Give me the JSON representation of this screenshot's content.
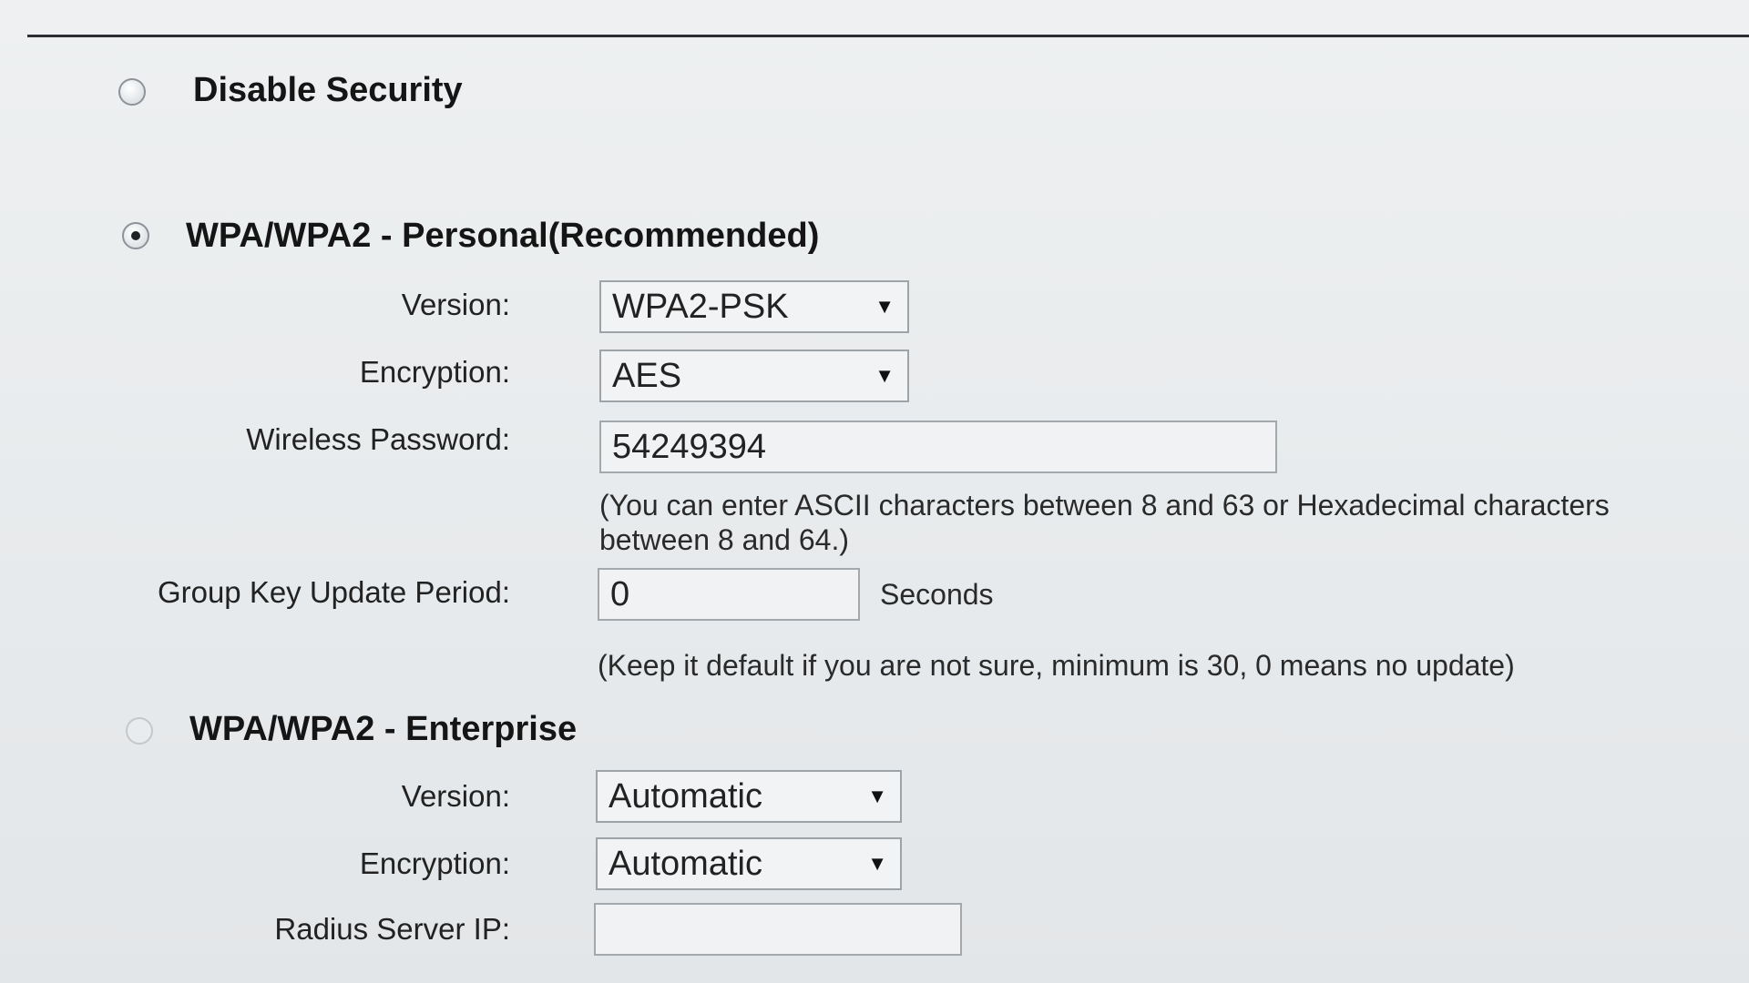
{
  "security": {
    "disable": {
      "label": "Disable Security",
      "selected": false
    },
    "personal": {
      "label": "WPA/WPA2 - Personal(Recommended)",
      "selected": true,
      "version_label": "Version:",
      "version_value": "WPA2-PSK",
      "encryption_label": "Encryption:",
      "encryption_value": "AES",
      "password_label": "Wireless Password:",
      "password_value": "54249394",
      "password_hint_line1": "(You can enter ASCII characters between 8 and 63 or Hexadecimal characters",
      "password_hint_line2": "between 8 and 64.)",
      "group_key_label": "Group Key Update Period:",
      "group_key_value": "0",
      "group_key_unit": "Seconds",
      "group_key_hint": "(Keep it default if you are not sure, minimum is 30, 0 means no update)"
    },
    "enterprise": {
      "label": "WPA/WPA2 - Enterprise",
      "selected": false,
      "version_label": "Version:",
      "version_value": "Automatic",
      "encryption_label": "Encryption:",
      "encryption_value": "Automatic",
      "radius_ip_label": "Radius Server IP:",
      "radius_ip_value": ""
    }
  },
  "icons": {
    "dropdown_arrow": "▼"
  }
}
